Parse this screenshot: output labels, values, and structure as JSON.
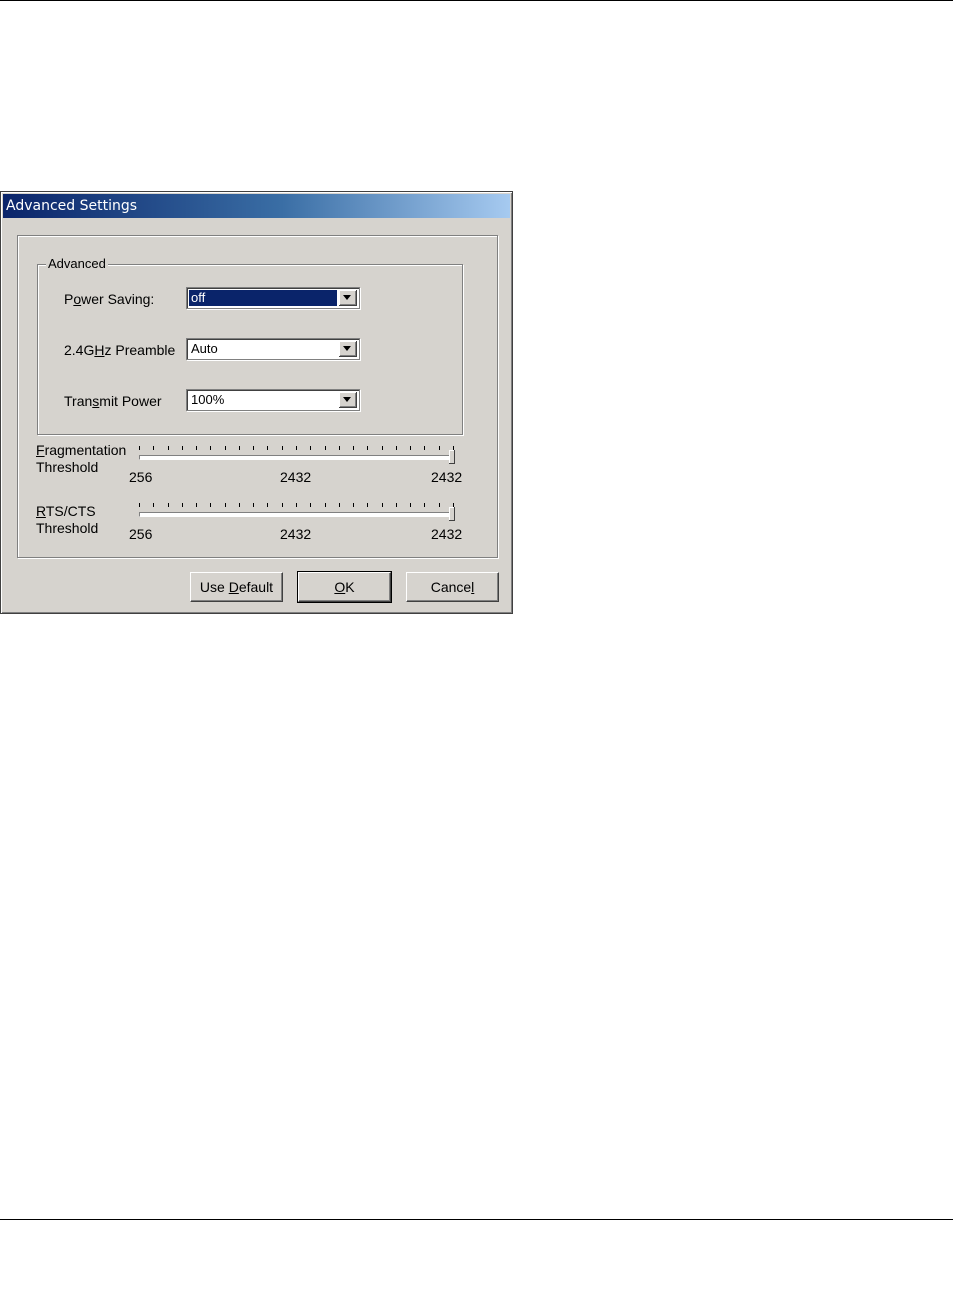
{
  "window": {
    "title": "Advanced Settings"
  },
  "group": {
    "label": "Advanced"
  },
  "fields": {
    "power_saving": {
      "label_pre": "P",
      "label_u": "o",
      "label_post": "wer Saving:",
      "value": "off"
    },
    "preamble": {
      "label_pre": "2.4G",
      "label_u": "H",
      "label_post": "z Preamble",
      "value": "Auto"
    },
    "transmit_power": {
      "label_pre": "Tran",
      "label_u": "s",
      "label_post": "mit Power",
      "value": "100%"
    }
  },
  "sliders": {
    "fragmentation": {
      "label_line1_u": "F",
      "label_line1_rest": "ragmentation",
      "label_line2": "Threshold",
      "min": "256",
      "mid": "2432",
      "max": "2432",
      "value": 2432
    },
    "rts_cts": {
      "label_line1_u": "R",
      "label_line1_rest": "TS/CTS",
      "label_line2": "Threshold",
      "min": "256",
      "mid": "2432",
      "max": "2432",
      "value": 2432
    }
  },
  "buttons": {
    "use_default": {
      "pre": "Use ",
      "u": "D",
      "post": "efault"
    },
    "ok": {
      "pre": "",
      "u": "O",
      "post": "K"
    },
    "cancel": {
      "pre": "Cance",
      "u": "l",
      "post": ""
    }
  }
}
